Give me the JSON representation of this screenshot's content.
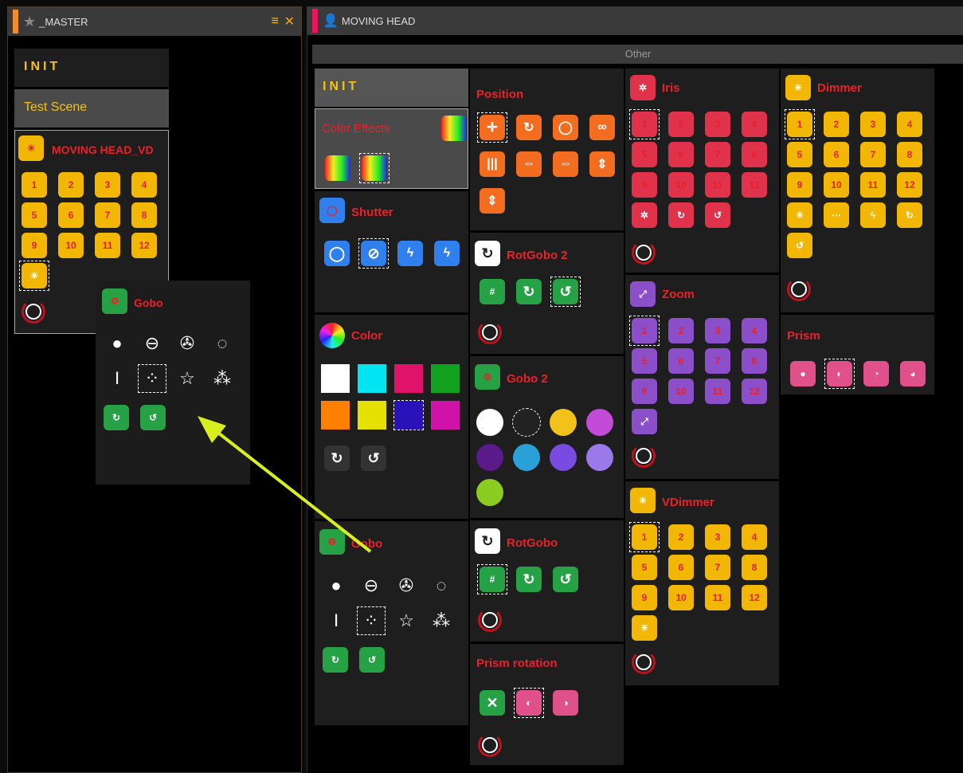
{
  "left_panel": {
    "title": "_MASTER",
    "init": "INIT",
    "test_scene": "Test Scene",
    "group_title": "MOVING HEAD_VD",
    "dimmer_nums": [
      "1",
      "2",
      "3",
      "4",
      "5",
      "6",
      "7",
      "8",
      "9",
      "10",
      "11",
      "12"
    ]
  },
  "popup": {
    "title": "Gobo"
  },
  "right_panel": {
    "title": "MOVING HEAD",
    "section": "Other",
    "init": "INIT",
    "color_effects": "Color Effects",
    "shutter": "Shutter",
    "color": "Color",
    "gobo": "Gobo",
    "position": "Position",
    "rotgobo2": "RotGobo 2",
    "gobo2": "Gobo 2",
    "rotgobo": "RotGobo",
    "prism_rotation": "Prism rotation",
    "iris": "Iris",
    "zoom": "Zoom",
    "vdimmer": "VDimmer",
    "dimmer": "Dimmer",
    "prism": "Prism",
    "nums": [
      "1",
      "2",
      "3",
      "4",
      "5",
      "6",
      "7",
      "8",
      "9",
      "10",
      "11",
      "12"
    ]
  },
  "colors": {
    "accent_left": "#f28c28",
    "accent_right": "#e8175d",
    "title_red": "#e8212a",
    "title_yellow": "#f2c21a"
  },
  "color_swatches": [
    "#ffffff",
    "#00e5f0",
    "#e0136a",
    "#12a020",
    "#ff8000",
    "#e6e000",
    "#2a12b8",
    "#d012a8"
  ]
}
